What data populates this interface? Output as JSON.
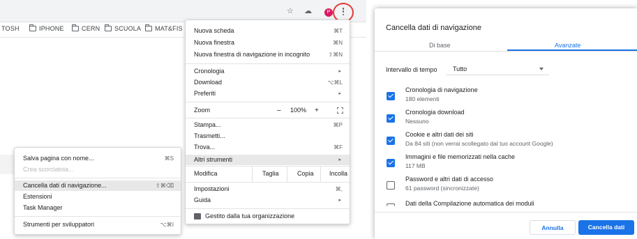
{
  "browser": {
    "avatar_letter": "P",
    "bookmarks": [
      "TOSH",
      "IPHONE",
      "CERN",
      "SCUOLA",
      "MAT&FIS"
    ],
    "toolbar_icons": [
      "star-icon",
      "extension-icon",
      "avatar",
      "more-vert-icon"
    ],
    "highlight_color": "#e53935"
  },
  "main_menu": {
    "new_tab": "Nuova scheda",
    "new_tab_sc": "⌘T",
    "new_window": "Nuova finestra",
    "new_window_sc": "⌘N",
    "incognito": "Nuova finestra di navigazione in incognito",
    "incognito_sc": "⇧⌘N",
    "history": "Cronologia",
    "downloads": "Download",
    "downloads_sc": "⌥⌘L",
    "bookmarks": "Preferiti",
    "zoom": "Zoom",
    "zoom_minus": "–",
    "zoom_value": "100%",
    "zoom_plus": "+",
    "print": "Stampa...",
    "print_sc": "⌘P",
    "cast": "Trasmetti...",
    "find": "Trova...",
    "find_sc": "⌘F",
    "more_tools": "Altri strumenti",
    "edit": "Modifica",
    "cut": "Taglia",
    "copy": "Copia",
    "paste": "Incolla",
    "settings": "Impostazioni",
    "settings_sc": "⌘,",
    "help": "Guida",
    "managed": "Gestito dalla tua organizzazione"
  },
  "sub_menu": {
    "save_page": "Salva pagina con nome...",
    "save_page_sc": "⌘S",
    "create_shortcut": "Crea scorciatoia...",
    "clear_data": "Cancella dati di navigazione...",
    "clear_data_sc": "⇧⌘⌫",
    "extensions": "Estensioni",
    "task_manager": "Task Manager",
    "dev_tools": "Strumenti per sviluppatori",
    "dev_tools_sc": "⌥⌘I"
  },
  "dialog": {
    "title": "Cancella dati di navigazione",
    "tab_basic": "Di base",
    "tab_advanced": "Avanzate",
    "time_range_label": "Intervallo di tempo",
    "time_range_value": "Tutto",
    "options": [
      {
        "title": "Cronologia di navigazione",
        "sub": "180 elementi",
        "checked": true
      },
      {
        "title": "Cronologia download",
        "sub": "Nessuno",
        "checked": true
      },
      {
        "title": "Cookie e altri dati dei siti",
        "sub": "Da 84 siti (non verrai scollegato dal tuo account Google)",
        "checked": true
      },
      {
        "title": "Immagini e file memorizzati nella cache",
        "sub": "117 MB",
        "checked": true
      },
      {
        "title": "Password e altri dati di accesso",
        "sub": "61 password (sincronizzate)",
        "checked": false
      },
      {
        "title": "Dati della Compilazione automatica dei moduli",
        "sub": "",
        "checked": false
      }
    ],
    "cancel_label": "Annulla",
    "confirm_label": "Cancella dati",
    "accent_color": "#1a73e8"
  }
}
